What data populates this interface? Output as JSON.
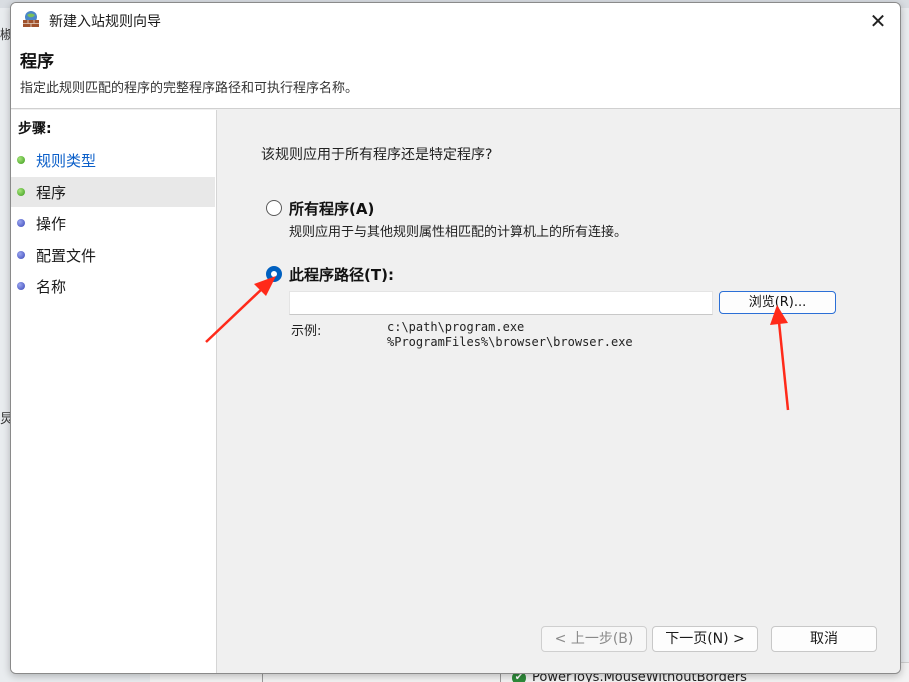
{
  "background": {
    "left_fragment_1": "椒",
    "left_fragment_2": "炅",
    "bottom_item": "PowerToys.MouseWithoutBorders"
  },
  "dialog": {
    "title": "新建入站规则向导",
    "header_title": "程序",
    "header_description": "指定此规则匹配的程序的完整程序路径和可执行程序名称。"
  },
  "steps": {
    "title": "步骤:",
    "items": [
      {
        "label": "规则类型",
        "status": "done"
      },
      {
        "label": "程序",
        "status": "current"
      },
      {
        "label": "操作",
        "status": "pending"
      },
      {
        "label": "配置文件",
        "status": "pending"
      },
      {
        "label": "名称",
        "status": "pending"
      }
    ]
  },
  "content": {
    "question": "该规则应用于所有程序还是特定程序?",
    "option_all": {
      "label": "所有程序(A)",
      "description": "规则应用于与其他规则属性相匹配的计算机上的所有连接。",
      "checked": false
    },
    "option_path": {
      "label": "此程序路径(T):",
      "checked": true
    },
    "path_input": {
      "value": "",
      "placeholder": ""
    },
    "browse_button": "浏览(R)...",
    "example_label": "示例:",
    "example_line_1": "c:\\path\\program.exe",
    "example_line_2": "%ProgramFiles%\\browser\\browser.exe"
  },
  "buttons": {
    "back": "< 上一步(B)",
    "next": "下一页(N) >",
    "cancel": "取消"
  },
  "colors": {
    "accent": "#0060c0",
    "step_link": "#0b5fc9",
    "annotation_arrow": "#ff2a1a"
  },
  "icons": {
    "app": "firewall-brick-globe-icon",
    "close": "close-icon"
  }
}
